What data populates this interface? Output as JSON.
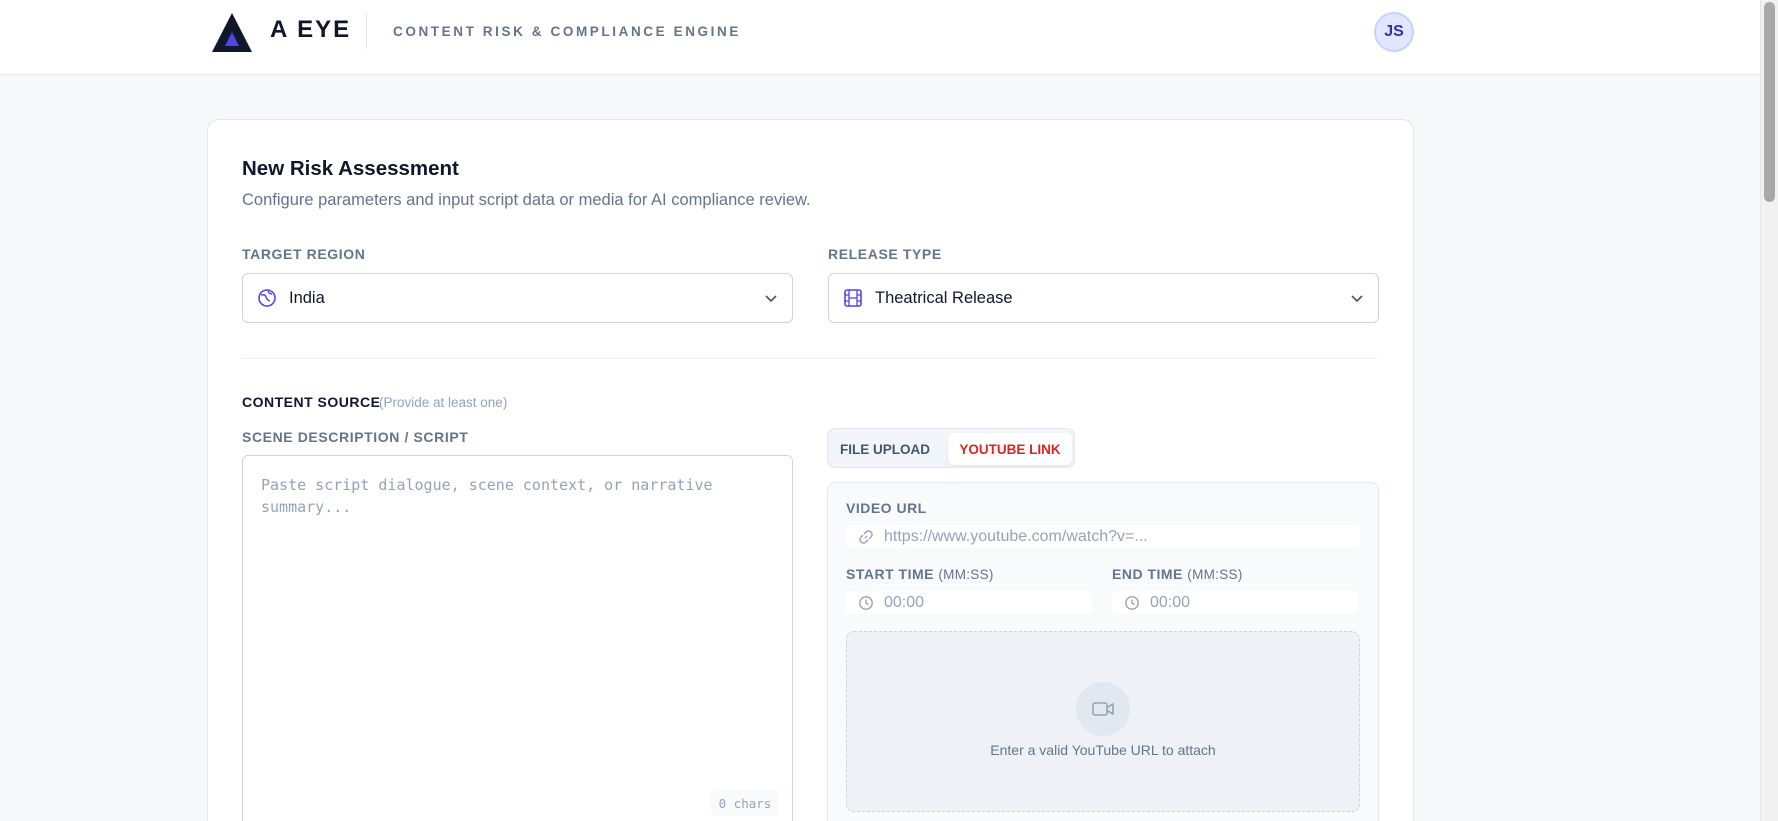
{
  "header": {
    "brand": "A EYE",
    "tagline": "CONTENT RISK & COMPLIANCE ENGINE",
    "avatar_initials": "JS",
    "logo_icon": "triangle-logo-icon"
  },
  "form": {
    "title": "New Risk Assessment",
    "subtitle": "Configure parameters and input script data or media for AI compliance review.",
    "target_region": {
      "label": "TARGET REGION",
      "value": "India",
      "icon": "globe-icon"
    },
    "release_type": {
      "label": "RELEASE TYPE",
      "value": "Theatrical Release",
      "icon": "film-icon"
    },
    "content_source": {
      "label": "CONTENT SOURCE",
      "hint": "(Provide at least one)"
    },
    "script": {
      "label": "SCENE DESCRIPTION / SCRIPT",
      "placeholder": "Paste script dialogue, scene context, or narrative summary...",
      "char_count": "0 chars"
    },
    "media_tabs": [
      {
        "label": "FILE UPLOAD",
        "active": false
      },
      {
        "label": "YOUTUBE LINK",
        "active": true
      }
    ],
    "youtube": {
      "url_label": "VIDEO URL",
      "url_placeholder": "https://www.youtube.com/watch?v=...",
      "start_label": "START TIME",
      "start_unit": "(MM:SS)",
      "start_placeholder": "00:00",
      "end_label": "END TIME",
      "end_unit": "(MM:SS)",
      "end_placeholder": "00:00",
      "drop_text": "Enter a valid YouTube URL to attach"
    }
  },
  "colors": {
    "accent": "#dc2626",
    "brand_indigo": "#4f46e5",
    "text_muted": "#64748b"
  }
}
